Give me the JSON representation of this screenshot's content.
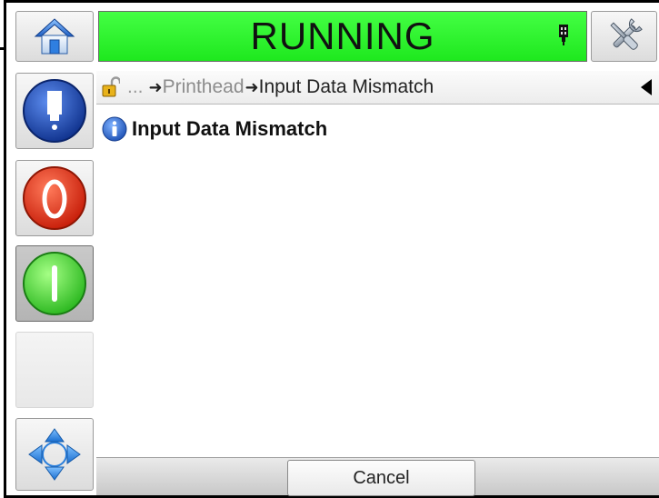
{
  "header": {
    "status": "RUNNING"
  },
  "breadcrumb": {
    "ellipsis": "...",
    "parent": "Printhead",
    "current": "Input Data Mismatch"
  },
  "message": {
    "title": "Input Data Mismatch"
  },
  "footer": {
    "cancel_label": "Cancel"
  },
  "colors": {
    "status_running": "#22ee22",
    "stop_red": "#e8331b",
    "start_green": "#55e04a",
    "home_blue": "#3b7bd6",
    "printhead_blue": "#1f4fb8",
    "info_blue": "#2a6fd6"
  },
  "icons": {
    "home": "home-icon",
    "tools": "tools-icon",
    "printhead": "printhead-icon",
    "stop": "stop-icon",
    "start": "start-icon",
    "navigate": "navigate-arrows-icon",
    "lock": "unlocked-lock-icon",
    "info": "info-icon",
    "back": "back-arrow-icon"
  }
}
